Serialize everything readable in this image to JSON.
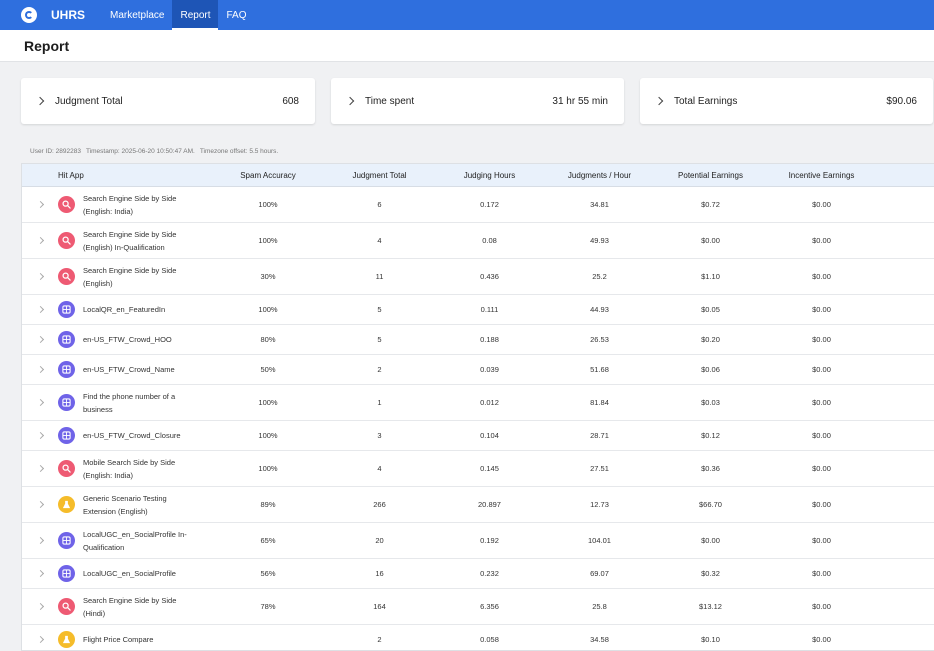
{
  "topbar": {
    "brand": "UHRS",
    "nav": [
      "Marketplace",
      "Report",
      "FAQ"
    ],
    "active": "Report"
  },
  "page": {
    "title": "Report"
  },
  "cards": [
    {
      "label": "Judgment Total",
      "value": "608"
    },
    {
      "label": "Time spent",
      "value": "31 hr 55 min"
    },
    {
      "label": "Total Earnings",
      "value": "$90.06"
    }
  ],
  "meta": {
    "user_id": "User ID: 2892283",
    "timestamp": "Timestamp: 2025-06-20 10:50:47 AM.",
    "timezone": "Timezone offset:  5.5 hours."
  },
  "table": {
    "columns": [
      "Hit App",
      "Spam Accuracy",
      "Judgment Total",
      "Judging Hours",
      "Judgments / Hour",
      "Potential Earnings",
      "Incentive Earnings"
    ],
    "rows": [
      {
        "icon": "search",
        "name": "Search Engine Side by Side (English: India)",
        "spam": "100%",
        "total": "6",
        "hours": "0.172",
        "jph": "34.81",
        "potential": "$0.72",
        "incentive": "$0.00"
      },
      {
        "icon": "search",
        "name": "Search Engine Side by Side (English) In-Qualification",
        "spam": "100%",
        "total": "4",
        "hours": "0.08",
        "jph": "49.93",
        "potential": "$0.00",
        "incentive": "$0.00"
      },
      {
        "icon": "search",
        "name": "Search Engine Side by Side (English)",
        "spam": "30%",
        "total": "11",
        "hours": "0.436",
        "jph": "25.2",
        "potential": "$1.10",
        "incentive": "$0.00"
      },
      {
        "icon": "grid",
        "name": "LocalQR_en_FeaturedIn",
        "spam": "100%",
        "total": "5",
        "hours": "0.111",
        "jph": "44.93",
        "potential": "$0.05",
        "incentive": "$0.00"
      },
      {
        "icon": "grid",
        "name": "en-US_FTW_Crowd_HOO",
        "spam": "80%",
        "total": "5",
        "hours": "0.188",
        "jph": "26.53",
        "potential": "$0.20",
        "incentive": "$0.00"
      },
      {
        "icon": "grid",
        "name": "en-US_FTW_Crowd_Name",
        "spam": "50%",
        "total": "2",
        "hours": "0.039",
        "jph": "51.68",
        "potential": "$0.06",
        "incentive": "$0.00"
      },
      {
        "icon": "grid",
        "name": "Find the phone number of a business",
        "spam": "100%",
        "total": "1",
        "hours": "0.012",
        "jph": "81.84",
        "potential": "$0.03",
        "incentive": "$0.00"
      },
      {
        "icon": "grid",
        "name": "en-US_FTW_Crowd_Closure",
        "spam": "100%",
        "total": "3",
        "hours": "0.104",
        "jph": "28.71",
        "potential": "$0.12",
        "incentive": "$0.00"
      },
      {
        "icon": "search",
        "name": "Mobile Search Side by Side (English: India)",
        "spam": "100%",
        "total": "4",
        "hours": "0.145",
        "jph": "27.51",
        "potential": "$0.36",
        "incentive": "$0.00"
      },
      {
        "icon": "flask",
        "name": "Generic Scenario Testing Extension (English)",
        "spam": "89%",
        "total": "266",
        "hours": "20.897",
        "jph": "12.73",
        "potential": "$66.70",
        "incentive": "$0.00"
      },
      {
        "icon": "grid",
        "name": "LocalUGC_en_SocialProfile In-Qualification",
        "spam": "65%",
        "total": "20",
        "hours": "0.192",
        "jph": "104.01",
        "potential": "$0.00",
        "incentive": "$0.00"
      },
      {
        "icon": "grid",
        "name": "LocalUGC_en_SocialProfile",
        "spam": "56%",
        "total": "16",
        "hours": "0.232",
        "jph": "69.07",
        "potential": "$0.32",
        "incentive": "$0.00"
      },
      {
        "icon": "search",
        "name": "Search Engine Side by Side (Hindi)",
        "spam": "78%",
        "total": "164",
        "hours": "6.356",
        "jph": "25.8",
        "potential": "$13.12",
        "incentive": "$0.00"
      },
      {
        "icon": "flask",
        "name": "Flight Price Compare",
        "spam": "",
        "total": "2",
        "hours": "0.058",
        "jph": "34.58",
        "potential": "$0.10",
        "incentive": "$0.00"
      }
    ]
  }
}
